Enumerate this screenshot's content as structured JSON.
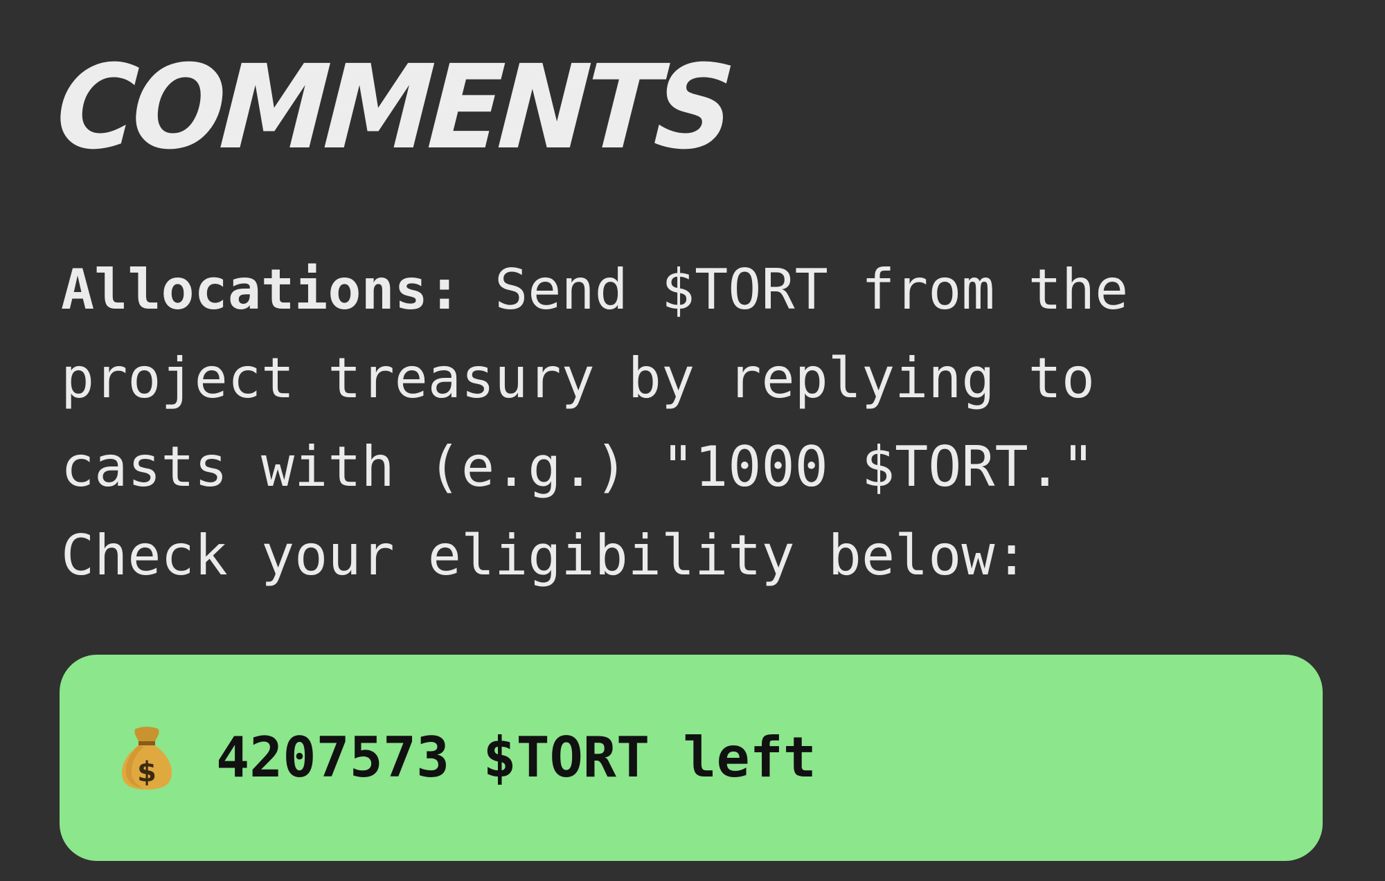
{
  "comments": {
    "title": "COMMENTS",
    "allocations": {
      "lead": "Allocations:",
      "lines": [
        " Send $TORT from the",
        "project treasury by replying to",
        "casts with (e.g.) \"1000 $TORT.\"",
        "Check your eligibility below:"
      ]
    },
    "remaining": {
      "icon": "money-bag-icon",
      "text": "4207573 $TORT left",
      "background_color": "#8ce68c"
    }
  }
}
